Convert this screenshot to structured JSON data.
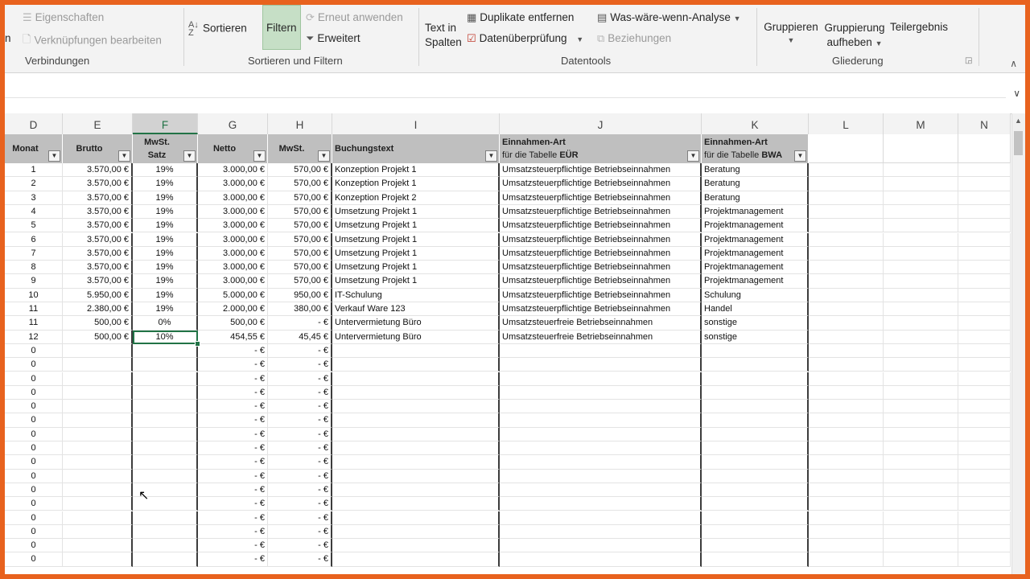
{
  "ribbon": {
    "eigenschaften": "Eigenschaften",
    "verknuepfungen": "Verknüpfungen bearbeiten",
    "partial_left": "n",
    "verbindungen_label": "Verbindungen",
    "sortieren": "Sortieren",
    "filtern": "Filtern",
    "erneut": "Erneut anwenden",
    "erweitert": "Erweitert",
    "sortieren_filtern_label": "Sortieren und Filtern",
    "text_in": "Text in",
    "spalten": "Spalten",
    "duplikate": "Duplikate entfernen",
    "datenueberpruefung": "Datenüberprüfung",
    "was_waere": "Was-wäre-wenn-Analyse",
    "beziehungen": "Beziehungen",
    "datentools_label": "Datentools",
    "gruppieren": "Gruppieren",
    "gruppierung": "Gruppierung",
    "aufheben": "aufheben",
    "teilergebnis": "Teilergebnis",
    "gliederung_label": "Gliederung"
  },
  "columns": [
    "D",
    "E",
    "F",
    "G",
    "H",
    "I",
    "J",
    "K",
    "L",
    "M",
    "N"
  ],
  "headers": {
    "monat": "Monat",
    "brutto": "Brutto",
    "mwst_satz_1": "MwSt.",
    "mwst_satz_2": "Satz",
    "netto": "Netto",
    "mwst": "MwSt.",
    "buchungstext": "Buchungstext",
    "einnahmen_j_1": "Einnahmen-Art",
    "einnahmen_j_2a": "für die Tabelle ",
    "einnahmen_j_2b": "EÜR",
    "einnahmen_k_1": "Einnahmen-Art",
    "einnahmen_k_2a": "für die Tabelle ",
    "einnahmen_k_2b": "BWA"
  },
  "rows": [
    {
      "monat": "1",
      "brutto": "3.570,00 €",
      "satz": "19%",
      "netto": "3.000,00 €",
      "mwst": "570,00 €",
      "text": "Konzeption Projekt 1",
      "euer": "Umsatzsteuerpflichtige Betriebseinnahmen",
      "bwa": "Beratung"
    },
    {
      "monat": "2",
      "brutto": "3.570,00 €",
      "satz": "19%",
      "netto": "3.000,00 €",
      "mwst": "570,00 €",
      "text": "Konzeption Projekt 1",
      "euer": "Umsatzsteuerpflichtige Betriebseinnahmen",
      "bwa": "Beratung"
    },
    {
      "monat": "3",
      "brutto": "3.570,00 €",
      "satz": "19%",
      "netto": "3.000,00 €",
      "mwst": "570,00 €",
      "text": "Konzeption Projekt 2",
      "euer": "Umsatzsteuerpflichtige Betriebseinnahmen",
      "bwa": "Beratung"
    },
    {
      "monat": "4",
      "brutto": "3.570,00 €",
      "satz": "19%",
      "netto": "3.000,00 €",
      "mwst": "570,00 €",
      "text": "Umsetzung Projekt 1",
      "euer": "Umsatzsteuerpflichtige Betriebseinnahmen",
      "bwa": "Projektmanagement"
    },
    {
      "monat": "5",
      "brutto": "3.570,00 €",
      "satz": "19%",
      "netto": "3.000,00 €",
      "mwst": "570,00 €",
      "text": "Umsetzung Projekt 1",
      "euer": "Umsatzsteuerpflichtige Betriebseinnahmen",
      "bwa": "Projektmanagement"
    },
    {
      "monat": "6",
      "brutto": "3.570,00 €",
      "satz": "19%",
      "netto": "3.000,00 €",
      "mwst": "570,00 €",
      "text": "Umsetzung Projekt 1",
      "euer": "Umsatzsteuerpflichtige Betriebseinnahmen",
      "bwa": "Projektmanagement"
    },
    {
      "monat": "7",
      "brutto": "3.570,00 €",
      "satz": "19%",
      "netto": "3.000,00 €",
      "mwst": "570,00 €",
      "text": "Umsetzung Projekt 1",
      "euer": "Umsatzsteuerpflichtige Betriebseinnahmen",
      "bwa": "Projektmanagement"
    },
    {
      "monat": "8",
      "brutto": "3.570,00 €",
      "satz": "19%",
      "netto": "3.000,00 €",
      "mwst": "570,00 €",
      "text": "Umsetzung Projekt 1",
      "euer": "Umsatzsteuerpflichtige Betriebseinnahmen",
      "bwa": "Projektmanagement"
    },
    {
      "monat": "9",
      "brutto": "3.570,00 €",
      "satz": "19%",
      "netto": "3.000,00 €",
      "mwst": "570,00 €",
      "text": "Umsetzung Projekt 1",
      "euer": "Umsatzsteuerpflichtige Betriebseinnahmen",
      "bwa": "Projektmanagement"
    },
    {
      "monat": "10",
      "brutto": "5.950,00 €",
      "satz": "19%",
      "netto": "5.000,00 €",
      "mwst": "950,00 €",
      "text": "IT-Schulung",
      "euer": "Umsatzsteuerpflichtige Betriebseinnahmen",
      "bwa": "Schulung"
    },
    {
      "monat": "11",
      "brutto": "2.380,00 €",
      "satz": "19%",
      "netto": "2.000,00 €",
      "mwst": "380,00 €",
      "text": "Verkauf Ware 123",
      "euer": "Umsatzsteuerpflichtige Betriebseinnahmen",
      "bwa": "Handel"
    },
    {
      "monat": "11",
      "brutto": "500,00 €",
      "satz": "0%",
      "netto": "500,00 €",
      "mwst": "-   €",
      "text": "Untervermietung Büro",
      "euer": "Umsatzsteuerfreie Betriebseinnahmen",
      "bwa": "sonstige"
    },
    {
      "monat": "12",
      "brutto": "500,00 €",
      "satz": "10%",
      "netto": "454,55 €",
      "mwst": "45,45 €",
      "text": "Untervermietung Büro",
      "euer": "Umsatzsteuerfreie Betriebseinnahmen",
      "bwa": "sonstige"
    }
  ],
  "empty_row": {
    "monat": "0",
    "netto": "-   €",
    "mwst": "-   €"
  },
  "empty_row_count": 16,
  "colors": {
    "accent": "#217346",
    "frame": "#e8621e",
    "header_fill": "#bfbfbf"
  }
}
